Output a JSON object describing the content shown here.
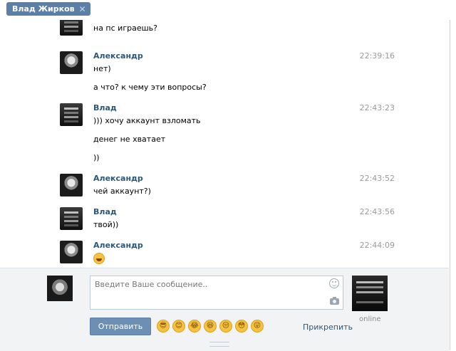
{
  "tab": {
    "title": "Влад Жирков",
    "close_icon": "✕"
  },
  "messages": [
    {
      "id": "m0",
      "author": "",
      "time": "",
      "lines": [
        "на пс играешь?"
      ]
    },
    {
      "id": "m1",
      "author": "Александр",
      "time": "22:39:16",
      "lines": [
        "нет)",
        "а что? к чему эти вопросы?"
      ]
    },
    {
      "id": "m2",
      "author": "Влад",
      "time": "22:43:23",
      "lines": [
        "))) хочу аккаунт взломать",
        "денег не хватает",
        "))"
      ]
    },
    {
      "id": "m3",
      "author": "Александр",
      "time": "22:43:52",
      "lines": [
        "чей аккаунт?)"
      ]
    },
    {
      "id": "m4",
      "author": "Влад",
      "time": "22:43:56",
      "lines": [
        "твой))"
      ]
    },
    {
      "id": "m5",
      "author": "Александр",
      "time": "22:44:09",
      "lines": []
    }
  ],
  "compose": {
    "placeholder": "Введите Ваше сообщение..",
    "send_label": "Отправить",
    "attach_label": "Прикрепить",
    "peer_status": "online",
    "emojis": [
      "😎",
      "😊",
      "😂",
      "😆",
      "😒",
      "😳",
      "😜"
    ]
  },
  "colors": {
    "accent": "#6d8fb3",
    "author": "#2b587a",
    "tab": "#5b7fa6"
  }
}
